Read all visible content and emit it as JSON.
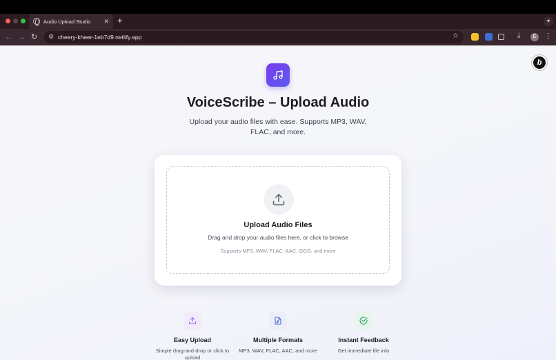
{
  "browser": {
    "tab_title": "Audio Upload Studio",
    "tab_close": "✕",
    "new_tab": "+",
    "url": "cheery-kheer-1eb7d9.netlify.app",
    "profile_initial": "E"
  },
  "header": {
    "title": "VoiceScribe – Upload Audio",
    "subtitle": "Upload your audio files with ease. Supports MP3, WAV, FLAC, and more.",
    "app_icon": "music-note-icon"
  },
  "upload": {
    "title": "Upload Audio Files",
    "description": "Drag and drop your audio files here, or click to browse",
    "formats": "Supports MP3, WAV, FLAC, AAC, OGG, and more",
    "icon": "upload-icon"
  },
  "features": [
    {
      "title": "Easy Upload",
      "description": "Simple drag-and-drop or click to upload",
      "icon": "upload-icon",
      "color": "#a855f7"
    },
    {
      "title": "Multiple Formats",
      "description": "MP3, WAV, FLAC, AAC, and more",
      "icon": "audio-file-icon",
      "color": "#4f6bd8"
    },
    {
      "title": "Instant Feedback",
      "description": "Get immediate file info",
      "icon": "check-circle-icon",
      "color": "#22a35a"
    }
  ],
  "colors": {
    "brand_gradient_start": "#7c3aed",
    "brand_gradient_end": "#5b5cf0"
  }
}
